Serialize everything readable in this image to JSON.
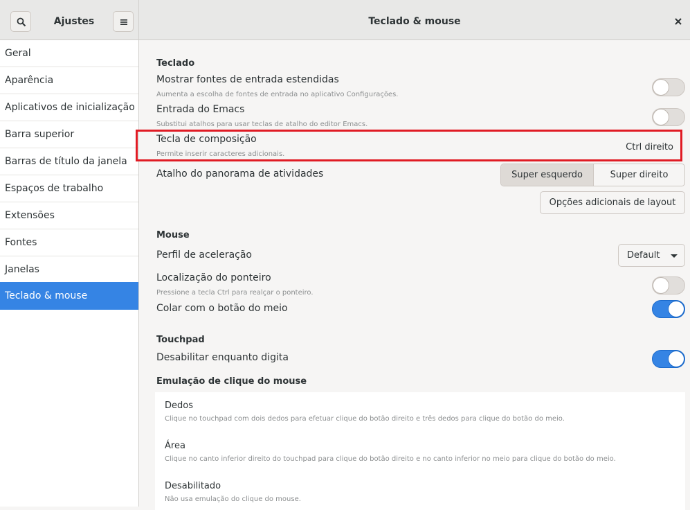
{
  "header": {
    "sidebar_title": "Ajustes",
    "title": "Teclado & mouse",
    "search_icon": "search-icon",
    "menu_icon": "hamburger-menu-icon",
    "close_icon": "close-icon"
  },
  "sidebar": {
    "items": [
      {
        "label": "Geral"
      },
      {
        "label": "Aparência"
      },
      {
        "label": "Aplicativos de inicialização"
      },
      {
        "label": "Barra superior"
      },
      {
        "label": "Barras de título da janela"
      },
      {
        "label": "Espaços de trabalho"
      },
      {
        "label": "Extensões"
      },
      {
        "label": "Fontes"
      },
      {
        "label": "Janelas"
      },
      {
        "label": "Teclado & mouse",
        "selected": true
      }
    ]
  },
  "keyboard": {
    "section": "Teclado",
    "extended_sources": {
      "label": "Mostrar fontes de entrada estendidas",
      "desc": "Aumenta a escolha de fontes de entrada no aplicativo Configurações.",
      "on": false
    },
    "emacs": {
      "label": "Entrada do Emacs",
      "desc": "Substitui atalhos para usar teclas de atalho do editor Emacs.",
      "on": false
    },
    "compose": {
      "label": "Tecla de composição",
      "desc": "Permite inserir caracteres adicionais.",
      "value": "Ctrl direito"
    },
    "overview": {
      "label": "Atalho do panorama de atividades",
      "left": "Super esquerdo",
      "right": "Super direito",
      "selected": "left"
    },
    "layout_button": "Opções adicionais de layout"
  },
  "mouse": {
    "section": "Mouse",
    "accel": {
      "label": "Perfil de aceleração",
      "value": "Default"
    },
    "locate": {
      "label": "Localização do ponteiro",
      "desc": "Pressione a tecla Ctrl para realçar o ponteiro.",
      "on": false
    },
    "middle": {
      "label": "Colar com o botão do meio",
      "on": true
    }
  },
  "touchpad": {
    "section": "Touchpad",
    "disable_typing": {
      "label": "Desabilitar enquanto digita",
      "on": true
    },
    "emulation_title": "Emulação de clique do mouse",
    "options": [
      {
        "title": "Dedos",
        "desc": "Clique no touchpad com dois dedos para efetuar clique do botão direito e três dedos para clique do botão do meio."
      },
      {
        "title": "Área",
        "desc": "Clique no canto inferior direito do touchpad para clique do botão direito e no canto inferior no meio para clique do botão do meio."
      },
      {
        "title": "Desabilitado",
        "desc": "Não usa emulação do clique do mouse."
      }
    ]
  },
  "colors": {
    "accent": "#3584e4",
    "highlight": "#e01b24"
  }
}
